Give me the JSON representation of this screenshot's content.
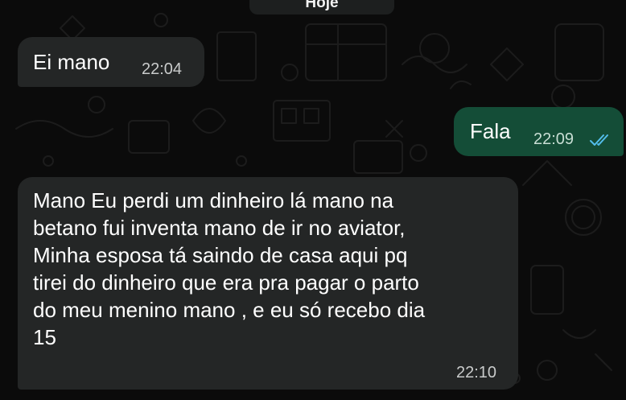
{
  "chat": {
    "date_label": "Hoje",
    "messages": [
      {
        "direction": "incoming",
        "text": "Ei mano",
        "time": "22:04"
      },
      {
        "direction": "outgoing",
        "text": "Fala",
        "time": "22:09",
        "status_icon": "double-check-read-icon"
      },
      {
        "direction": "incoming",
        "text": "Mano Eu perdi um dinheiro lá mano na\nbetano fui inventa mano de ir no aviator,\nMinha esposa tá saindo de casa aqui pq\ntirei do dinheiro que era pra pagar o parto\ndo meu menino mano , e eu só recebo dia\n15",
        "time": "22:10"
      }
    ]
  },
  "colors": {
    "background": "#0b0b0b",
    "incoming_bubble": "#242626",
    "outgoing_bubble": "#144d37",
    "read_ticks": "#53bdeb"
  }
}
